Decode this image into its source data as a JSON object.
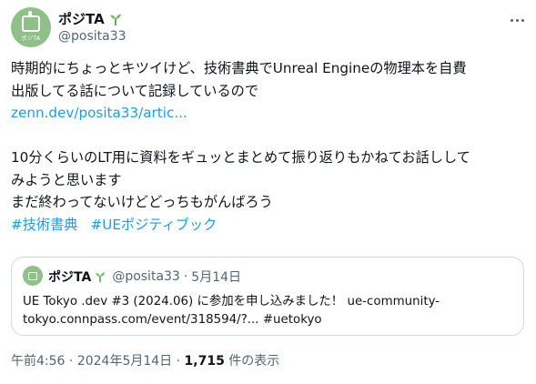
{
  "author": {
    "display_name": "ポジTA",
    "handle": "@posita33",
    "avatar_text": "ポジTA",
    "avatar_color": "#8fc08a"
  },
  "tweet": {
    "lines": [
      "時期的にちょっとキツイけど、技術書典でUnreal  Engineの物理本を自費",
      "出版してる話について記録しているので"
    ],
    "link": "zenn.dev/posita33/artic...",
    "lines2": [
      "10分くらいのLT用に資料をギュッとまとめて振り返りもかねてお話しして",
      "みようと思います",
      "まだ終わってないけどどっちもがんばろう"
    ],
    "hashtags": [
      "#技術書典",
      "#UEポジティブック"
    ]
  },
  "quote": {
    "display_name": "ポジTA",
    "handle": "@posita33",
    "separator": "·",
    "date": "5月14日",
    "lines": [
      "UE Tokyo .dev #3 (2024.06) に参加を申し込みました！  ue-community-",
      "tokyo.connpass.com/event/318594/?... #uetokyo"
    ]
  },
  "footer": {
    "time": "午前4:56",
    "separator": "·",
    "date": "2024年5月14日",
    "views_count": "1,715",
    "views_label": "件の表示"
  },
  "colors": {
    "link": "#1d9bf0",
    "muted": "#536471",
    "text": "#0f1419",
    "border": "#cfd9de"
  },
  "icons": {
    "more": "more-horizontal-icon",
    "badge": "sprout-icon"
  }
}
